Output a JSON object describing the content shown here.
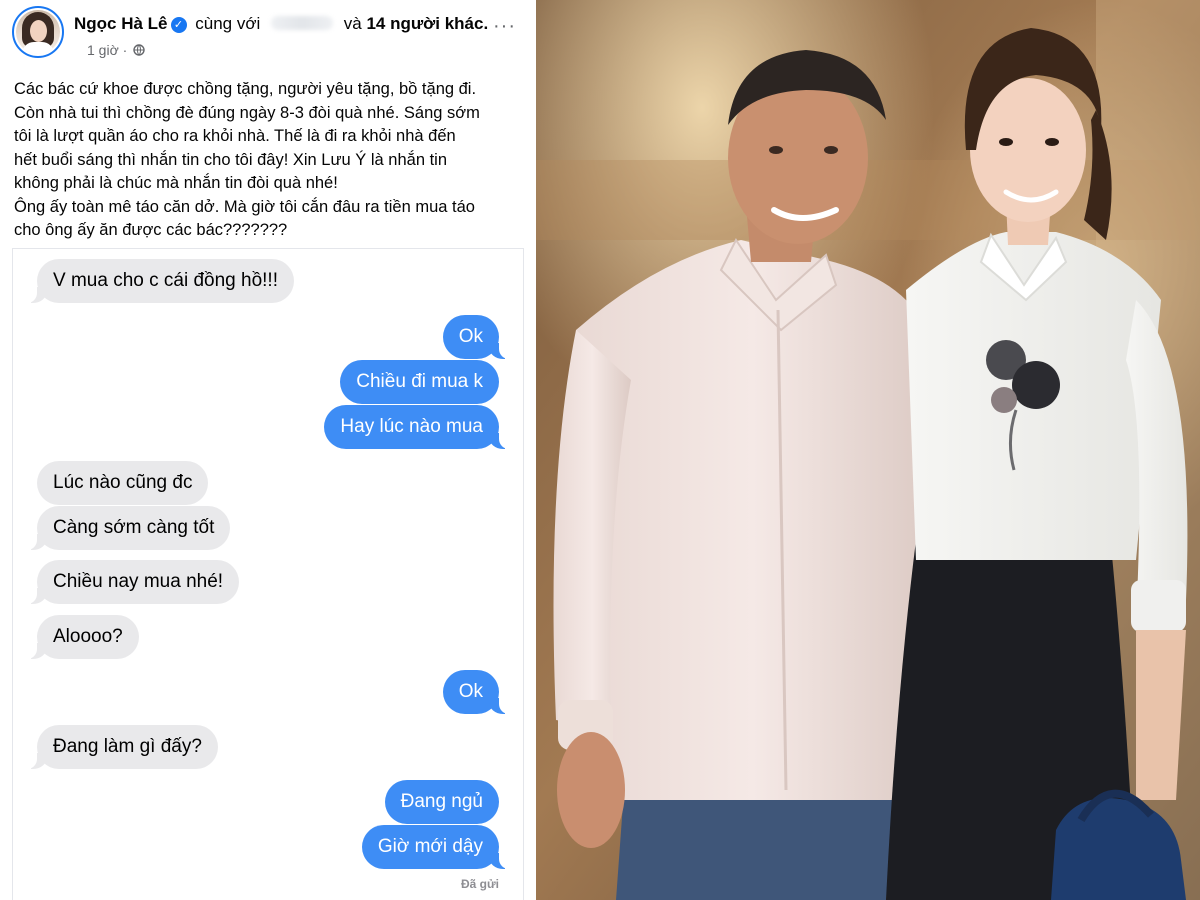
{
  "post": {
    "author": "Ngọc Hà Lê",
    "with_prefix": "cùng với",
    "with_and": "và",
    "tagged_count": "14 người khác.",
    "time": "1 giờ",
    "separator": "·",
    "more": "···",
    "text_lines": [
      "Các bác cứ khoe được chồng tặng, người yêu tặng, bồ tặng đi.",
      "Còn nhà tui thì chồng đè đúng ngày 8-3 đòi quà nhé. Sáng sớm",
      "tôi là lượt quần áo cho ra khỏi nhà. Thế là đi ra khỏi nhà đến",
      "hết buổi sáng thì nhắn tin cho tôi đây! Xin Lưu Ý là nhắn tin",
      "không phải là chúc mà nhắn tin đòi quà nhé!",
      "Ông ấy toàn mê táo căn dở. Mà giờ tôi cắn đâu ra tiền mua táo",
      "cho ông ấy ăn được các bác???????"
    ]
  },
  "chat": {
    "messages": [
      {
        "dir": "in",
        "text": "V mua cho c cái đồng hồ!!!"
      },
      {
        "dir": "out",
        "text": "Ok"
      },
      {
        "dir": "out",
        "text": "Chiều đi mua k"
      },
      {
        "dir": "out",
        "text": "Hay lúc nào mua"
      },
      {
        "dir": "in",
        "text": "Lúc nào cũng đc"
      },
      {
        "dir": "in",
        "text": "Càng sớm càng tốt"
      },
      {
        "dir": "in",
        "text": "Chiều nay mua nhé!"
      },
      {
        "dir": "in",
        "text": "Aloooo?"
      },
      {
        "dir": "out",
        "text": "Ok"
      },
      {
        "dir": "in",
        "text": "Đang làm gì đấy?"
      },
      {
        "dir": "out",
        "text": "Đang ngủ"
      },
      {
        "dir": "out",
        "text": "Giờ mới dậy"
      }
    ],
    "status": "Đã gửi"
  },
  "colors": {
    "facebook_blue": "#1877f2",
    "imessage_blue": "#3e8df5",
    "bubble_gray": "#e9e9eb"
  }
}
